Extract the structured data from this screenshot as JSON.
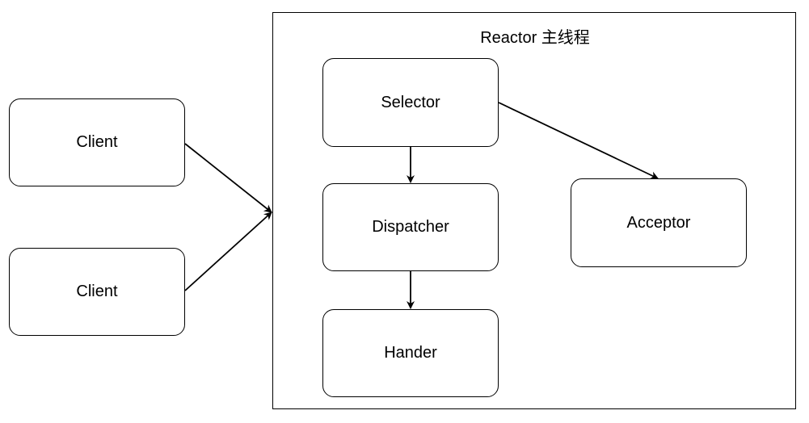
{
  "container": {
    "title": "Reactor 主线程"
  },
  "nodes": {
    "client_1": "Client",
    "client_2": "Client",
    "selector": "Selector",
    "dispatcher": "Dispatcher",
    "hander": "Hander",
    "acceptor": "Acceptor"
  },
  "edges": [
    {
      "from": "Client",
      "to": "Reactor 主线程"
    },
    {
      "from": "Client",
      "to": "Reactor 主线程"
    },
    {
      "from": "Selector",
      "to": "Dispatcher"
    },
    {
      "from": "Selector",
      "to": "Acceptor"
    },
    {
      "from": "Dispatcher",
      "to": "Hander"
    }
  ]
}
